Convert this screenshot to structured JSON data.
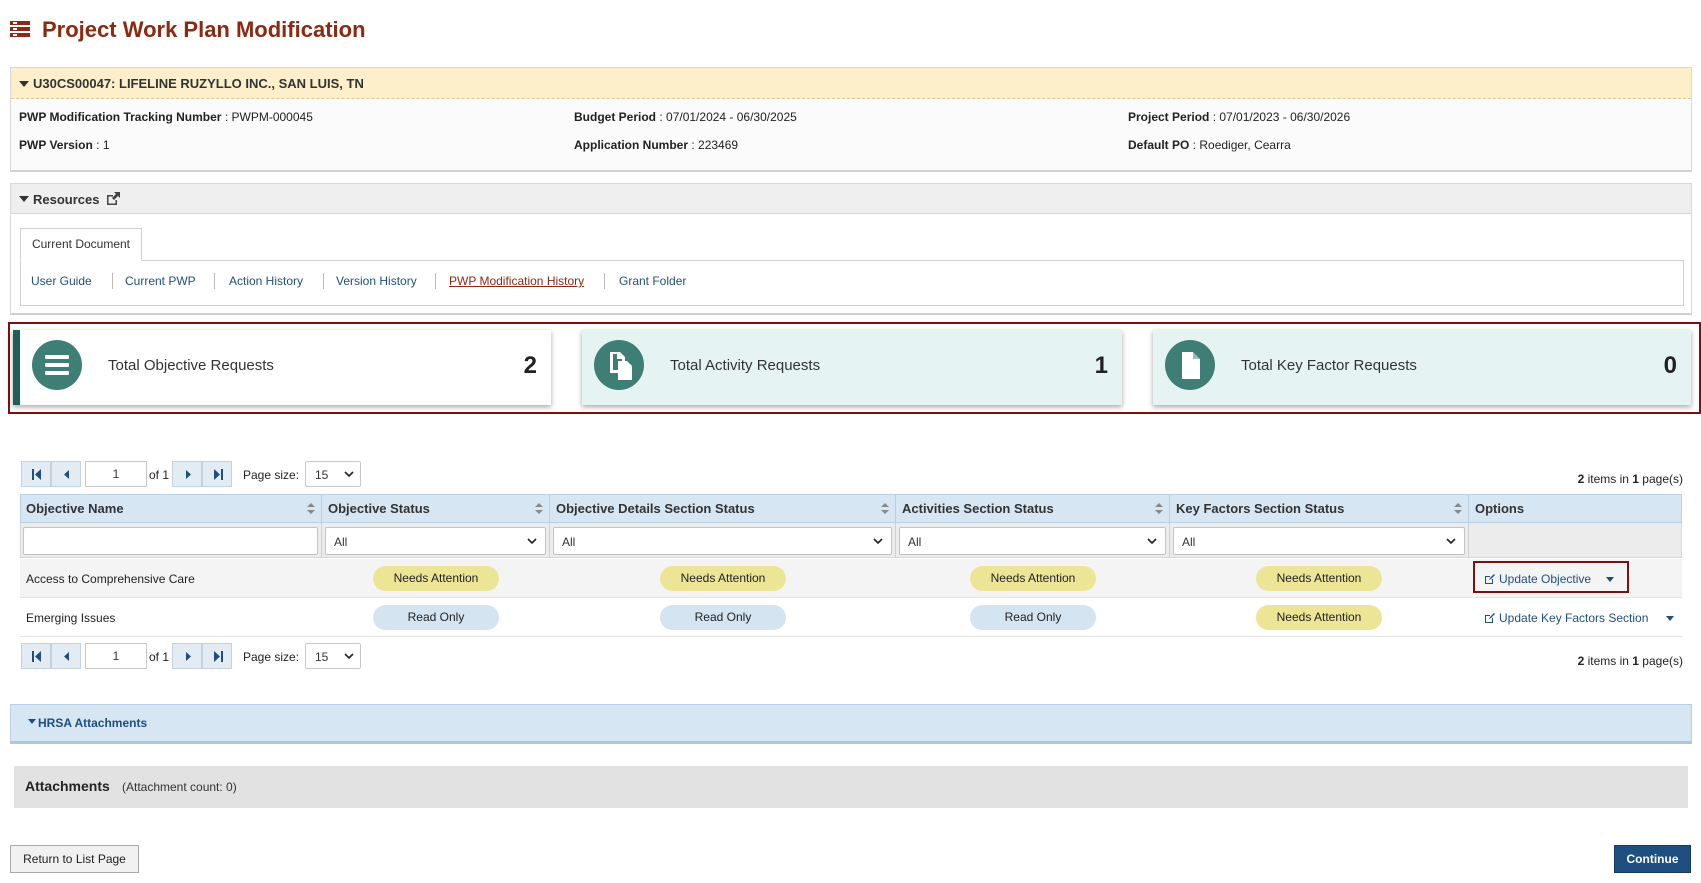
{
  "page": {
    "title": "Project Work Plan Modification",
    "title_icon": "list-icon"
  },
  "grant": {
    "header": "U30CS00047: LIFELINE RUZYLLO INC., SAN LUIS, TN",
    "fields": [
      {
        "label": "PWP Modification Tracking Number",
        "value": "PWPM-000045"
      },
      {
        "label": "Budget Period",
        "value": "07/01/2024 - 06/30/2025"
      },
      {
        "label": "Project Period",
        "value": "07/01/2023 - 06/30/2026"
      },
      {
        "label": "PWP Version",
        "value": "1"
      },
      {
        "label": "Application Number",
        "value": "223469"
      },
      {
        "label": "Default PO",
        "value": "Roediger, Cearra"
      }
    ],
    "sep": " : "
  },
  "resources": {
    "title": "Resources",
    "tab": "Current Document",
    "links": [
      "User Guide",
      "Current PWP",
      "Action History",
      "Version History",
      "PWP Modification History",
      "Grant Folder"
    ]
  },
  "summary": [
    {
      "label": "Total Objective Requests",
      "value": "2",
      "icon": "list-icon"
    },
    {
      "label": "Total Activity Requests",
      "value": "1",
      "icon": "documents-icon"
    },
    {
      "label": "Total Key Factor Requests",
      "value": "0",
      "icon": "document-icon"
    }
  ],
  "pager": {
    "page": "1",
    "of_text": "of 1",
    "page_size_label": "Page size:",
    "page_size": "15",
    "items_count": "2",
    "items_text_1": " items in ",
    "pages_count": "1",
    "items_text_2": " page(s)"
  },
  "grid": {
    "columns": [
      "Objective Name",
      "Objective Status",
      "Objective Details Section Status",
      "Activities Section Status",
      "Key Factors Section Status",
      "Options"
    ],
    "filter_all": "All",
    "rows": [
      {
        "name": "Access to Comprehensive Care",
        "statuses": [
          "Needs Attention",
          "Needs Attention",
          "Needs Attention",
          "Needs Attention"
        ],
        "option": "Update Objective"
      },
      {
        "name": "Emerging Issues",
        "statuses": [
          "Read Only",
          "Read Only",
          "Read Only",
          "Needs Attention"
        ],
        "option": "Update Key Factors Section"
      }
    ]
  },
  "attachments": {
    "hrsa_title": "HRSA Attachments",
    "title": "Attachments",
    "count_text": "(Attachment count: 0)"
  },
  "footer": {
    "return_label": "Return to List Page",
    "continue_label": "Continue"
  },
  "colors": {
    "title": "#8b2a10",
    "accent": "#3f7e74",
    "link": "#1f4f80",
    "highlight": "#7a1010"
  }
}
